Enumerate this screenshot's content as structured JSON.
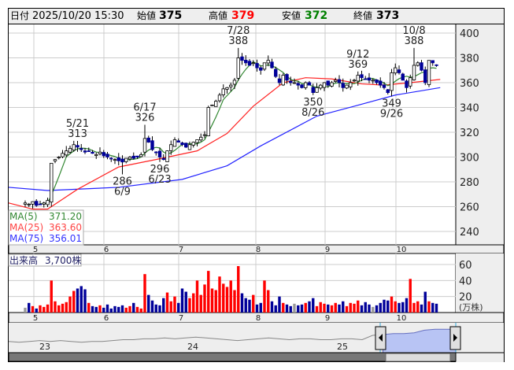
{
  "header": {
    "date_label": "日付",
    "datetime": "2025/10/20 15:30",
    "open_label": "始値",
    "open": "375",
    "high_label": "高値",
    "high": "379",
    "low_label": "安値",
    "low": "372",
    "close_label": "終値",
    "close": "373"
  },
  "colors": {
    "up_fill": "#ffffff",
    "down_fill": "#000099",
    "vol_up": "#ff0000",
    "vol_down": "#000099",
    "vol_flat": "#999999",
    "ma5": "#338833",
    "ma25": "#ff2222",
    "ma75": "#2222ff",
    "high_value": "#ff0000",
    "low_value": "#008000",
    "nav_area": "#b8c4f4"
  },
  "price_axis": {
    "ticks": [
      "400",
      "380",
      "360",
      "340",
      "320",
      "300",
      "280",
      "260",
      "240"
    ],
    "min": 240,
    "max": 400
  },
  "month_labels": [
    "5",
    "6",
    "7",
    "8",
    "9",
    "10"
  ],
  "legend": [
    {
      "name": "MA(5)",
      "value": "371.20"
    },
    {
      "name": "MA(25)",
      "value": "363.60"
    },
    {
      "name": "MA(75)",
      "value": "356.01"
    }
  ],
  "volume": {
    "label": "出来高",
    "value": "3,700株",
    "ticks": [
      "60",
      "40",
      "20"
    ],
    "unit": "(万株)"
  },
  "annotations": [
    {
      "date": "5/21",
      "price": "313",
      "index": 14,
      "pos": "above"
    },
    {
      "date": "6/9",
      "price": "286",
      "index": 26,
      "pos": "below"
    },
    {
      "date": "6/17",
      "price": "326",
      "index": 32,
      "pos": "above"
    },
    {
      "date": "6/23",
      "price": "296",
      "index": 36,
      "pos": "below"
    },
    {
      "date": "7/28",
      "price": "388",
      "index": 57,
      "pos": "above"
    },
    {
      "date": "8/26",
      "price": "350",
      "index": 77,
      "pos": "below"
    },
    {
      "date": "9/12",
      "price": "369",
      "index": 89,
      "pos": "above"
    },
    {
      "date": "9/26",
      "price": "349",
      "index": 98,
      "pos": "below"
    },
    {
      "date": "10/8",
      "price": "388",
      "index": 104,
      "pos": "above"
    }
  ],
  "navigator": {
    "year_labels": [
      "23",
      "24",
      "25"
    ]
  },
  "chart_data": {
    "type": "candlestick",
    "closes": [
      263,
      262,
      264,
      261,
      262,
      263,
      265,
      295,
      298,
      300,
      303,
      305,
      307,
      310,
      308,
      306,
      304,
      305,
      303,
      302,
      304,
      301,
      300,
      299,
      298,
      297,
      296,
      299,
      300,
      299,
      300,
      302,
      315,
      312,
      306,
      304,
      300,
      298,
      305,
      310,
      314,
      312,
      310,
      308,
      310,
      312,
      314,
      316,
      318,
      340,
      342,
      345,
      350,
      355,
      356,
      358,
      362,
      380,
      378,
      376,
      374,
      376,
      372,
      370,
      376,
      378,
      372,
      365,
      360,
      366,
      362,
      360,
      360,
      358,
      356,
      360,
      358,
      352,
      356,
      358,
      360,
      358,
      360,
      362,
      360,
      356,
      358,
      360,
      362,
      366,
      364,
      363,
      362,
      362,
      360,
      358,
      356,
      352,
      368,
      372,
      368,
      362,
      356,
      364,
      374,
      376,
      370,
      360,
      378,
      376,
      374
    ],
    "volumes": [
      6,
      12,
      8,
      5,
      9,
      7,
      10,
      40,
      14,
      9,
      11,
      13,
      20,
      27,
      30,
      33,
      29,
      12,
      8,
      7,
      9,
      6,
      10,
      5,
      8,
      7,
      9,
      6,
      8,
      12,
      7,
      5,
      48,
      22,
      15,
      10,
      9,
      18,
      25,
      14,
      20,
      12,
      30,
      26,
      18,
      24,
      40,
      22,
      35,
      52,
      30,
      28,
      45,
      36,
      32,
      40,
      28,
      58,
      24,
      18,
      16,
      22,
      10,
      12,
      40,
      28,
      14,
      9,
      20,
      12,
      10,
      8,
      11,
      9,
      10,
      12,
      14,
      18,
      8,
      13,
      11,
      10,
      9,
      12,
      10,
      14,
      8,
      12,
      11,
      15,
      9,
      13,
      10,
      7,
      9,
      12,
      16,
      15,
      20,
      14,
      12,
      13,
      18,
      42,
      12,
      14,
      10,
      26,
      14,
      12,
      11
    ],
    "ma25": [
      [
        -5,
        263
      ],
      [
        2,
        258
      ],
      [
        6,
        258
      ],
      [
        14,
        274
      ],
      [
        25,
        292
      ],
      [
        35,
        298
      ],
      [
        46,
        305
      ],
      [
        54,
        319
      ],
      [
        61,
        341
      ],
      [
        69,
        360
      ],
      [
        75,
        364
      ],
      [
        82,
        363
      ],
      [
        90,
        359
      ],
      [
        96,
        358
      ],
      [
        103,
        360
      ],
      [
        111,
        362.6
      ]
    ],
    "ma75": [
      [
        -5,
        275.6
      ],
      [
        6,
        273
      ],
      [
        25,
        275.6
      ],
      [
        42,
        282
      ],
      [
        54,
        293
      ],
      [
        63,
        309
      ],
      [
        78,
        333
      ],
      [
        88,
        341
      ],
      [
        99,
        350
      ],
      [
        111,
        356
      ]
    ],
    "nav_series": [
      33,
      32,
      33,
      34,
      33,
      34,
      33,
      32,
      33,
      33,
      34,
      35,
      35,
      36,
      36,
      37,
      36,
      37,
      38,
      37,
      36,
      35,
      34,
      35,
      36,
      37,
      36,
      35,
      36,
      36,
      35,
      35,
      36,
      36,
      35,
      40,
      41,
      42,
      42,
      43,
      46,
      47,
      47,
      47
    ]
  }
}
